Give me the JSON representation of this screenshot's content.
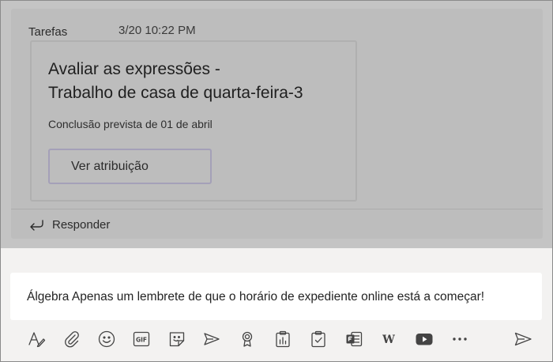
{
  "post": {
    "author": "Tarefas",
    "timestamp": "3/20 10:22 PM",
    "card": {
      "title_line1": "Avaliar as expressões -",
      "title_line2": "Trabalho de casa de quarta-feira-3",
      "due": "Conclusão prevista de 01 de abril",
      "button_label": "Ver atribuição"
    },
    "reply_label": "Responder"
  },
  "composer": {
    "text": "Álgebra Apenas um lembrete de que o horário de expediente online está a começar!",
    "toolbar": [
      "format-icon",
      "attach-icon",
      "emoji-icon",
      "gif-icon",
      "sticker-icon",
      "stream-icon",
      "praise-icon",
      "insights-icon",
      "assignments-icon",
      "forms-icon",
      "wiki-icon",
      "youtube-icon",
      "more-icon",
      "send-icon"
    ]
  },
  "colors": {
    "accent": "#6264a7",
    "overlay": "#bdbdbd"
  }
}
